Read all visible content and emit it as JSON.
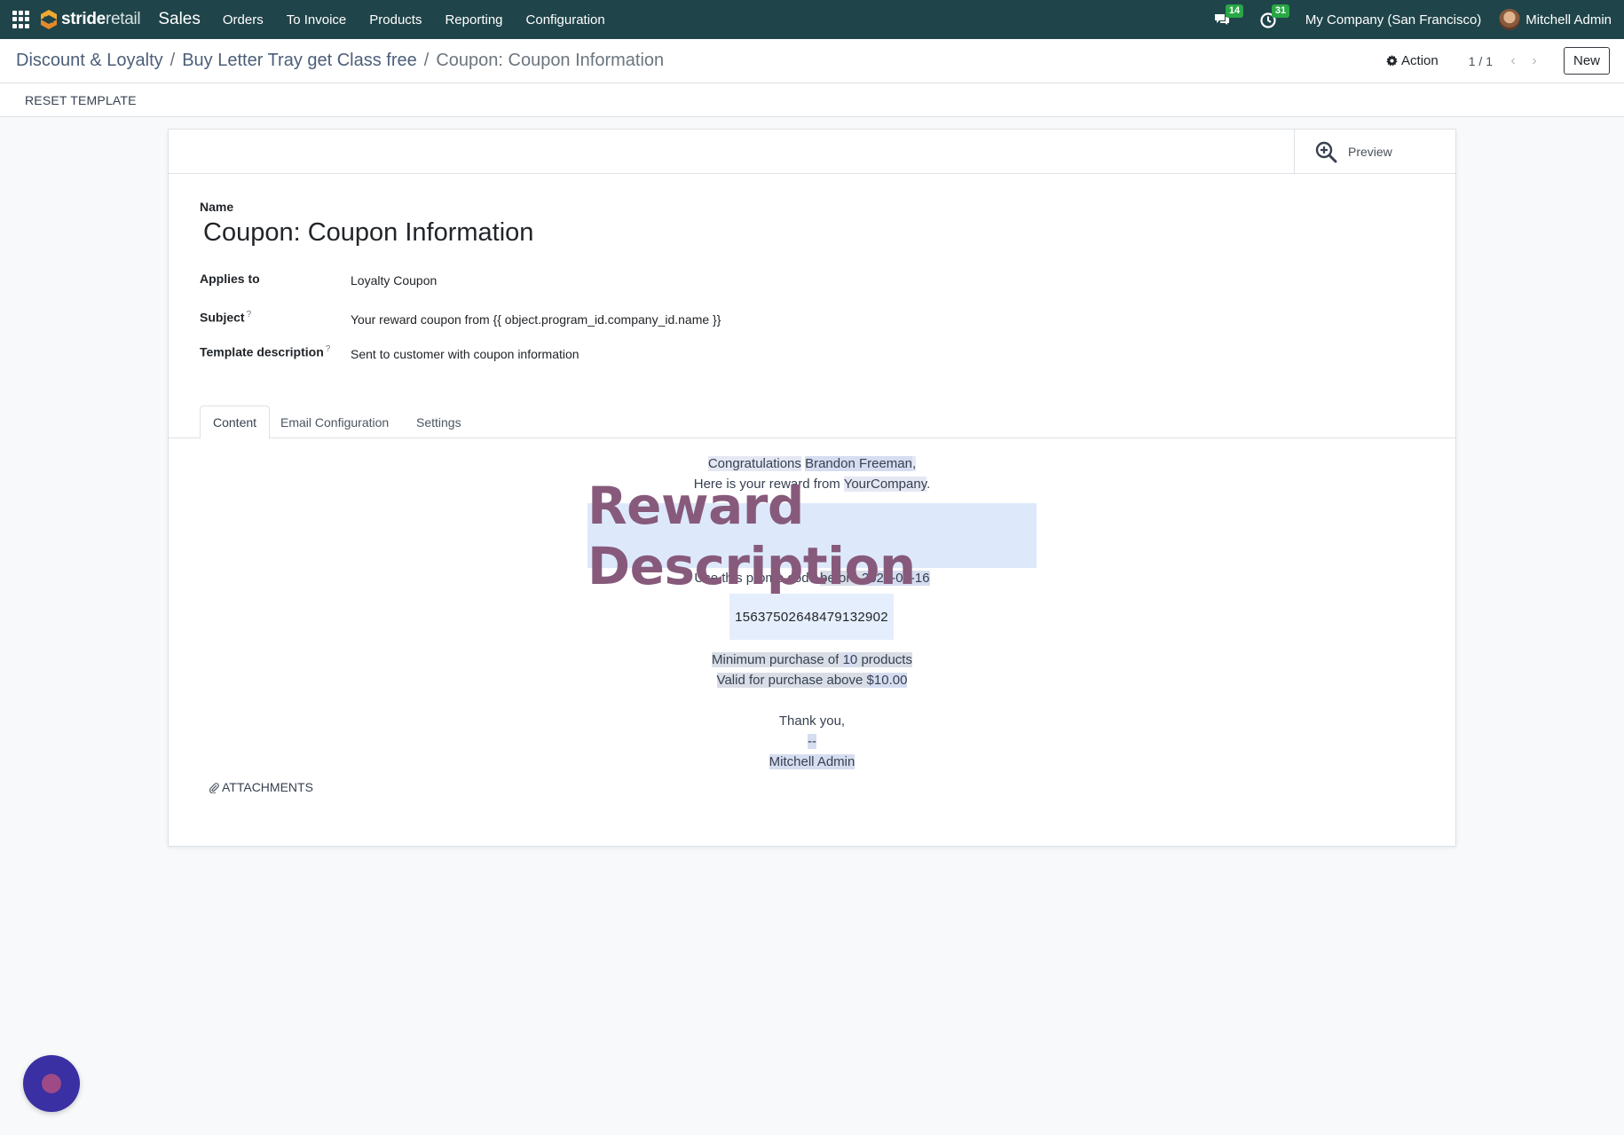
{
  "navbar": {
    "brand_part1": "stride",
    "brand_part2": "retail",
    "app_name": "Sales",
    "menu": [
      "Orders",
      "To Invoice",
      "Products",
      "Reporting",
      "Configuration"
    ],
    "messages_count": "14",
    "activities_count": "31",
    "company": "My Company (San Francisco)",
    "user": "Mitchell Admin"
  },
  "control_panel": {
    "breadcrumbs": [
      "Discount & Loyalty",
      "Buy Letter Tray get Class free",
      "Coupon: Coupon Information"
    ],
    "separator": "/",
    "action_label": "Action",
    "pager": "1 / 1",
    "new_label": "New"
  },
  "status_bar": {
    "reset_label": "RESET TEMPLATE"
  },
  "form": {
    "preview_label": "Preview",
    "name_label": "Name",
    "name_value": "Coupon: Coupon Information",
    "applies_to_label": "Applies to",
    "applies_to_value": "Loyalty Coupon",
    "subject_label": "Subject",
    "subject_value": "Your reward coupon from {{ object.program_id.company_id.name }}",
    "description_label": "Template description",
    "description_value": "Sent to customer with coupon information",
    "help_mark": "?",
    "tabs": [
      "Content",
      "Email Configuration",
      "Settings"
    ],
    "attachments_label": "ATTACHMENTS"
  },
  "email": {
    "congrats": "Congratulations",
    "customer": "Brandon Freeman",
    "congrats_end": ",",
    "reward_from": "Here is your reward from",
    "company": "YourCompany",
    "period": ".",
    "reward_title": "Reward Description",
    "promo_text": "Use this promo code",
    "before": "before",
    "expiry": "2021-06-16",
    "code": "1563750264847913290 2",
    "min_purchase_pre": "Minimum purchase of",
    "min_qty": "10",
    "min_purchase_post": "products",
    "valid_pre": "Valid for purchase above",
    "valid_amount": "$10.00",
    "thanks": "Thank you,",
    "sig_sep": "--",
    "signature": "Mitchell Admin"
  },
  "colors": {
    "navbar": "#1f4449",
    "reward_title": "#875a7b",
    "badge": "#28a745",
    "fab": "#3a2fa3"
  }
}
